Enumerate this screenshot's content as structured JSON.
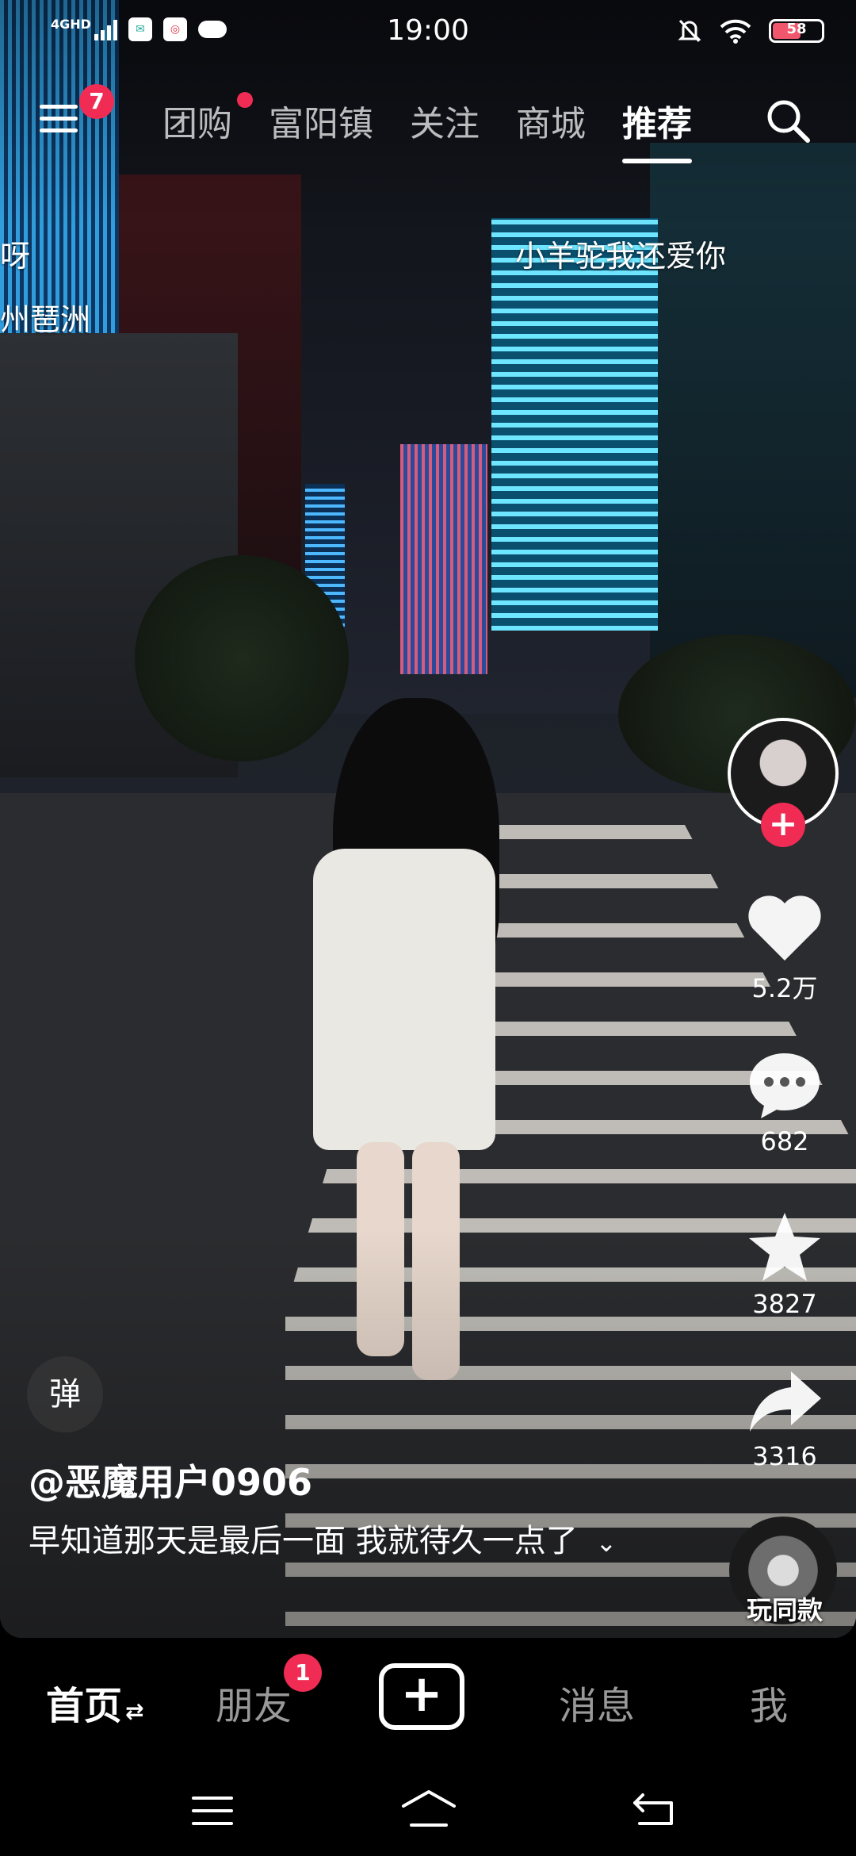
{
  "status_bar": {
    "network": "4GHD",
    "time": "19:00",
    "battery_level": "58",
    "battery_percent": 58,
    "icons": [
      "signal-icon",
      "app-notification-icon",
      "app-notification-icon",
      "cloud-icon",
      "mute-icon",
      "wifi-icon",
      "battery-icon"
    ]
  },
  "top_nav": {
    "menu_badge": "7",
    "tabs": [
      {
        "label": "团购",
        "has_dot": true
      },
      {
        "label": "富阳镇"
      },
      {
        "label": "关注"
      },
      {
        "label": "商城"
      },
      {
        "label": "推荐",
        "active": true
      }
    ]
  },
  "danmaku": [
    {
      "text": "呀"
    },
    {
      "text": "州琶洲"
    },
    {
      "text": "小羊驼我还爱你"
    }
  ],
  "actions": {
    "like_count": "5.2万",
    "comment_count": "682",
    "favorite_count": "3827",
    "share_count": "3316"
  },
  "video": {
    "danmaku_toggle_label": "弹",
    "author": "@恶魔用户0906",
    "caption": "早知道那天是最后一面 我就待久一点了",
    "music_label": "玩同款"
  },
  "bottom_nav": {
    "home": "首页",
    "friends": "朋友",
    "friends_badge": "1",
    "messages": "消息",
    "me": "我"
  },
  "colors": {
    "accent": "#f02c55",
    "background": "#000000",
    "text": "#ffffff"
  }
}
